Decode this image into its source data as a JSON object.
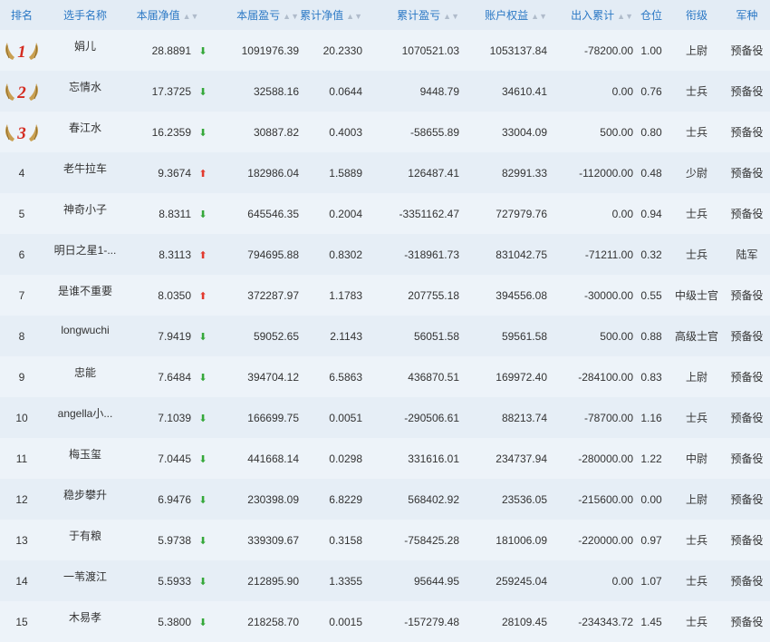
{
  "headers": {
    "rank": "排名",
    "name": "选手名称",
    "nav": "本届净值",
    "pnl": "本届盈亏",
    "cum_nav": "累计净值",
    "cum_pnl": "累计盈亏",
    "equity": "账户权益",
    "inout": "出入累计",
    "position": "仓位",
    "title": "衔级",
    "branch": "军种"
  },
  "sort_icon": "sort-icon",
  "colors": {
    "header_text": "#2b78c5",
    "up": "#e23a2e",
    "down": "#35a83a",
    "medal_number": "#d42b20"
  },
  "rows": [
    {
      "rank": "1",
      "medal": true,
      "name": "娟儿",
      "nav": "28.8891",
      "dir": "down",
      "pnl": "1091976.39",
      "cum_nav": "20.2330",
      "cum_pnl": "1070521.03",
      "equity": "1053137.84",
      "inout": "-78200.00",
      "position": "1.00",
      "title": "上尉",
      "branch": "预备役"
    },
    {
      "rank": "2",
      "medal": true,
      "name": "忘情水",
      "nav": "17.3725",
      "dir": "down",
      "pnl": "32588.16",
      "cum_nav": "0.0644",
      "cum_pnl": "9448.79",
      "equity": "34610.41",
      "inout": "0.00",
      "position": "0.76",
      "title": "士兵",
      "branch": "预备役"
    },
    {
      "rank": "3",
      "medal": true,
      "name": "春江水",
      "nav": "16.2359",
      "dir": "down",
      "pnl": "30887.82",
      "cum_nav": "0.4003",
      "cum_pnl": "-58655.89",
      "equity": "33004.09",
      "inout": "500.00",
      "position": "0.80",
      "title": "士兵",
      "branch": "预备役"
    },
    {
      "rank": "4",
      "medal": false,
      "name": "老牛拉车",
      "nav": "9.3674",
      "dir": "up",
      "pnl": "182986.04",
      "cum_nav": "1.5889",
      "cum_pnl": "126487.41",
      "equity": "82991.33",
      "inout": "-112000.00",
      "position": "0.48",
      "title": "少尉",
      "branch": "预备役"
    },
    {
      "rank": "5",
      "medal": false,
      "name": "神奇小子",
      "nav": "8.8311",
      "dir": "down",
      "pnl": "645546.35",
      "cum_nav": "0.2004",
      "cum_pnl": "-3351162.47",
      "equity": "727979.76",
      "inout": "0.00",
      "position": "0.94",
      "title": "士兵",
      "branch": "预备役"
    },
    {
      "rank": "6",
      "medal": false,
      "name": "明日之星1-...",
      "nav": "8.3113",
      "dir": "up",
      "pnl": "794695.88",
      "cum_nav": "0.8302",
      "cum_pnl": "-318961.73",
      "equity": "831042.75",
      "inout": "-71211.00",
      "position": "0.32",
      "title": "士兵",
      "branch": "陆军"
    },
    {
      "rank": "7",
      "medal": false,
      "name": "是谁不重要",
      "nav": "8.0350",
      "dir": "up",
      "pnl": "372287.97",
      "cum_nav": "1.1783",
      "cum_pnl": "207755.18",
      "equity": "394556.08",
      "inout": "-30000.00",
      "position": "0.55",
      "title": "中级士官",
      "branch": "预备役"
    },
    {
      "rank": "8",
      "medal": false,
      "name": "longwuchi",
      "nav": "7.9419",
      "dir": "down",
      "pnl": "59052.65",
      "cum_nav": "2.1143",
      "cum_pnl": "56051.58",
      "equity": "59561.58",
      "inout": "500.00",
      "position": "0.88",
      "title": "高级士官",
      "branch": "预备役"
    },
    {
      "rank": "9",
      "medal": false,
      "name": "忠能",
      "nav": "7.6484",
      "dir": "down",
      "pnl": "394704.12",
      "cum_nav": "6.5863",
      "cum_pnl": "436870.51",
      "equity": "169972.40",
      "inout": "-284100.00",
      "position": "0.83",
      "title": "上尉",
      "branch": "预备役"
    },
    {
      "rank": "10",
      "medal": false,
      "name": "angella小...",
      "nav": "7.1039",
      "dir": "down",
      "pnl": "166699.75",
      "cum_nav": "0.0051",
      "cum_pnl": "-290506.61",
      "equity": "88213.74",
      "inout": "-78700.00",
      "position": "1.16",
      "title": "士兵",
      "branch": "预备役"
    },
    {
      "rank": "11",
      "medal": false,
      "name": "梅玉玺",
      "nav": "7.0445",
      "dir": "down",
      "pnl": "441668.14",
      "cum_nav": "0.0298",
      "cum_pnl": "331616.01",
      "equity": "234737.94",
      "inout": "-280000.00",
      "position": "1.22",
      "title": "中尉",
      "branch": "预备役"
    },
    {
      "rank": "12",
      "medal": false,
      "name": "稳步攀升",
      "nav": "6.9476",
      "dir": "down",
      "pnl": "230398.09",
      "cum_nav": "6.8229",
      "cum_pnl": "568402.92",
      "equity": "23536.05",
      "inout": "-215600.00",
      "position": "0.00",
      "title": "上尉",
      "branch": "预备役"
    },
    {
      "rank": "13",
      "medal": false,
      "name": "于有粮",
      "nav": "5.9738",
      "dir": "down",
      "pnl": "339309.67",
      "cum_nav": "0.3158",
      "cum_pnl": "-758425.28",
      "equity": "181006.09",
      "inout": "-220000.00",
      "position": "0.97",
      "title": "士兵",
      "branch": "预备役"
    },
    {
      "rank": "14",
      "medal": false,
      "name": "一苇渡江",
      "nav": "5.5933",
      "dir": "down",
      "pnl": "212895.90",
      "cum_nav": "1.3355",
      "cum_pnl": "95644.95",
      "equity": "259245.04",
      "inout": "0.00",
      "position": "1.07",
      "title": "士兵",
      "branch": "预备役"
    },
    {
      "rank": "15",
      "medal": false,
      "name": "木易孝",
      "nav": "5.3800",
      "dir": "down",
      "pnl": "218258.70",
      "cum_nav": "0.0015",
      "cum_pnl": "-157279.48",
      "equity": "28109.45",
      "inout": "-234343.72",
      "position": "1.45",
      "title": "士兵",
      "branch": "预备役"
    }
  ]
}
